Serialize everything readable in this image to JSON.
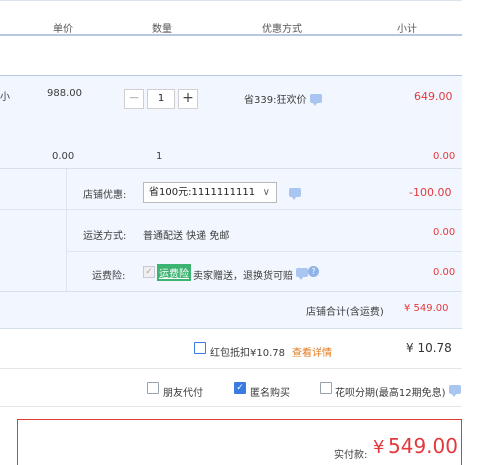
{
  "header": {
    "unit_price": "单价",
    "quantity": "数量",
    "discount_method": "优惠方式",
    "subtotal": "小计"
  },
  "item": {
    "name_fragment": "小",
    "price": "988.00",
    "qty_minus": "−",
    "qty_value": "1",
    "qty_plus": "+",
    "promo": "省339:狂欢价",
    "subtotal": "649.00"
  },
  "extra_row": {
    "price": "0.00",
    "qty": "1",
    "subtotal": "0.00"
  },
  "store": {
    "coupon_label": "店铺优惠:",
    "coupon_select": "省100元:1111111111",
    "coupon_value": "-100.00",
    "shipping_label": "运送方式:",
    "shipping_value": "普通配送 快递 免邮",
    "shipping_amount": "0.00",
    "insurance_label": "运费险:",
    "insurance_badge": "运费险",
    "insurance_text": "卖家赠送，退换货可赔",
    "insurance_amount": "0.00",
    "total_label": "店铺合计(含运费)",
    "total_value": "¥ 549.00"
  },
  "redpacket": {
    "label": "红包抵扣¥10.78",
    "link": "查看详情",
    "amount": "¥ 10.78"
  },
  "options": {
    "friend_pay": "朋友代付",
    "anonymous": "匿名购买",
    "installment": "花呗分期(最高12期免息)"
  },
  "payment": {
    "label": "实付款:",
    "currency": "¥",
    "amount": "549.00"
  },
  "colors": {
    "accent_red": "#e4393c",
    "blue_bg": "#f2f7ff",
    "link_orange": "#ff7a00",
    "badge_green": "#3cb371"
  }
}
